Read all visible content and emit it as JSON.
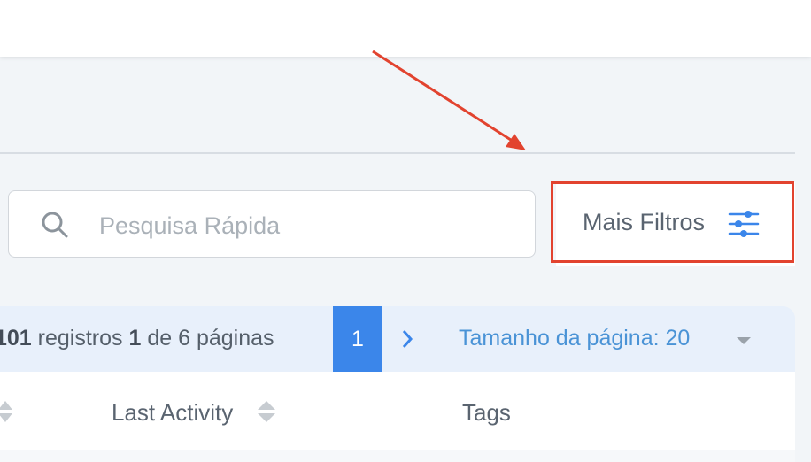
{
  "search": {
    "placeholder": "Pesquisa Rápida"
  },
  "filters": {
    "label": "Mais Filtros",
    "icon": "sliders-icon",
    "highlight_color": "#e2432f"
  },
  "pagination": {
    "total": "101",
    "records_word": " registros ",
    "current": "1",
    "of_pages": " de 6 páginas",
    "page_button": "1",
    "page_size_label": "Tamanho da página: 20",
    "accent": "#3b86ea"
  },
  "table": {
    "columns": [
      {
        "label": "Last Activity"
      },
      {
        "label": "Tags"
      }
    ]
  }
}
